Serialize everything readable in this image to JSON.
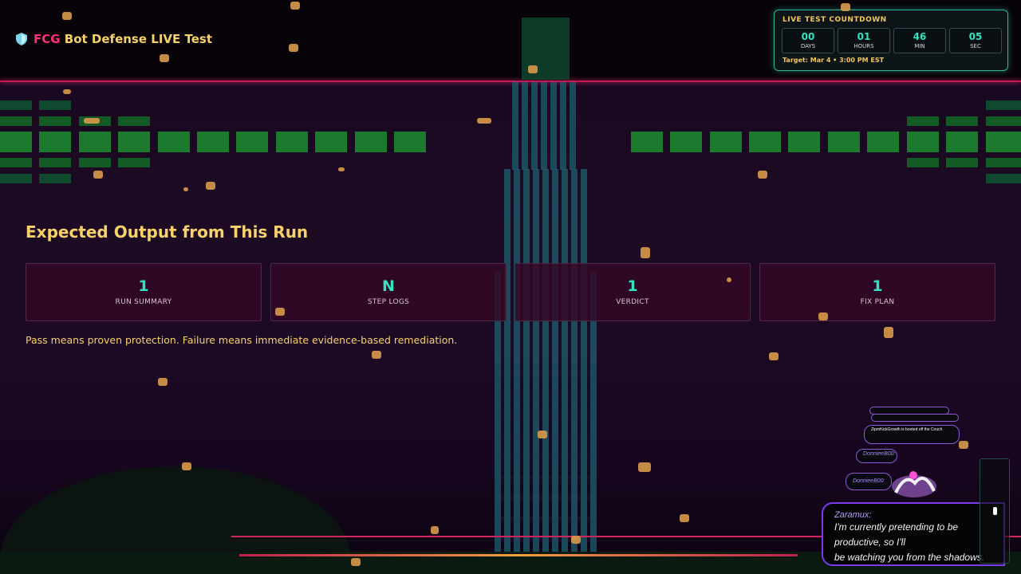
{
  "header": {
    "brand_prefix": "FCG",
    "brand_rest": " Bot Defense LIVE Test"
  },
  "countdown": {
    "title": "LIVE TEST COUNTDOWN",
    "cells": [
      {
        "value": "00",
        "label": "DAYS"
      },
      {
        "value": "01",
        "label": "HOURS"
      },
      {
        "value": "46",
        "label": "MIN"
      },
      {
        "value": "05",
        "label": "SEC"
      }
    ],
    "target": "Target: Mar 4 • 3:00 PM EST"
  },
  "main": {
    "heading": "Expected Output from This Run",
    "cards": [
      {
        "value": "1",
        "label": "RUN SUMMARY"
      },
      {
        "value": "N",
        "label": "STEP LOGS"
      },
      {
        "value": "1",
        "label": "VERDICT"
      },
      {
        "value": "1",
        "label": "FIX PLAN"
      }
    ],
    "tagline": "Pass means proven protection. Failure means immediate evidence-based remediation."
  },
  "chat": {
    "messages": [
      {
        "user": "ZipmKickGrowth is booted off the Couch",
        "text": ""
      },
      {
        "user": "DonnieeB00:",
        "text": ""
      },
      {
        "user": "DonnieeB00:",
        "text": ""
      }
    ],
    "featured": {
      "user": "Zaramux:",
      "line1": "I'm currently pretending to be productive, so I'll",
      "line2": "be watching you from the shadows."
    }
  },
  "colors": {
    "accent_pink": "#ff2d7a",
    "accent_gold": "#f7d26b",
    "accent_teal": "#36e3c1",
    "chat_purple": "#7c3aed"
  }
}
